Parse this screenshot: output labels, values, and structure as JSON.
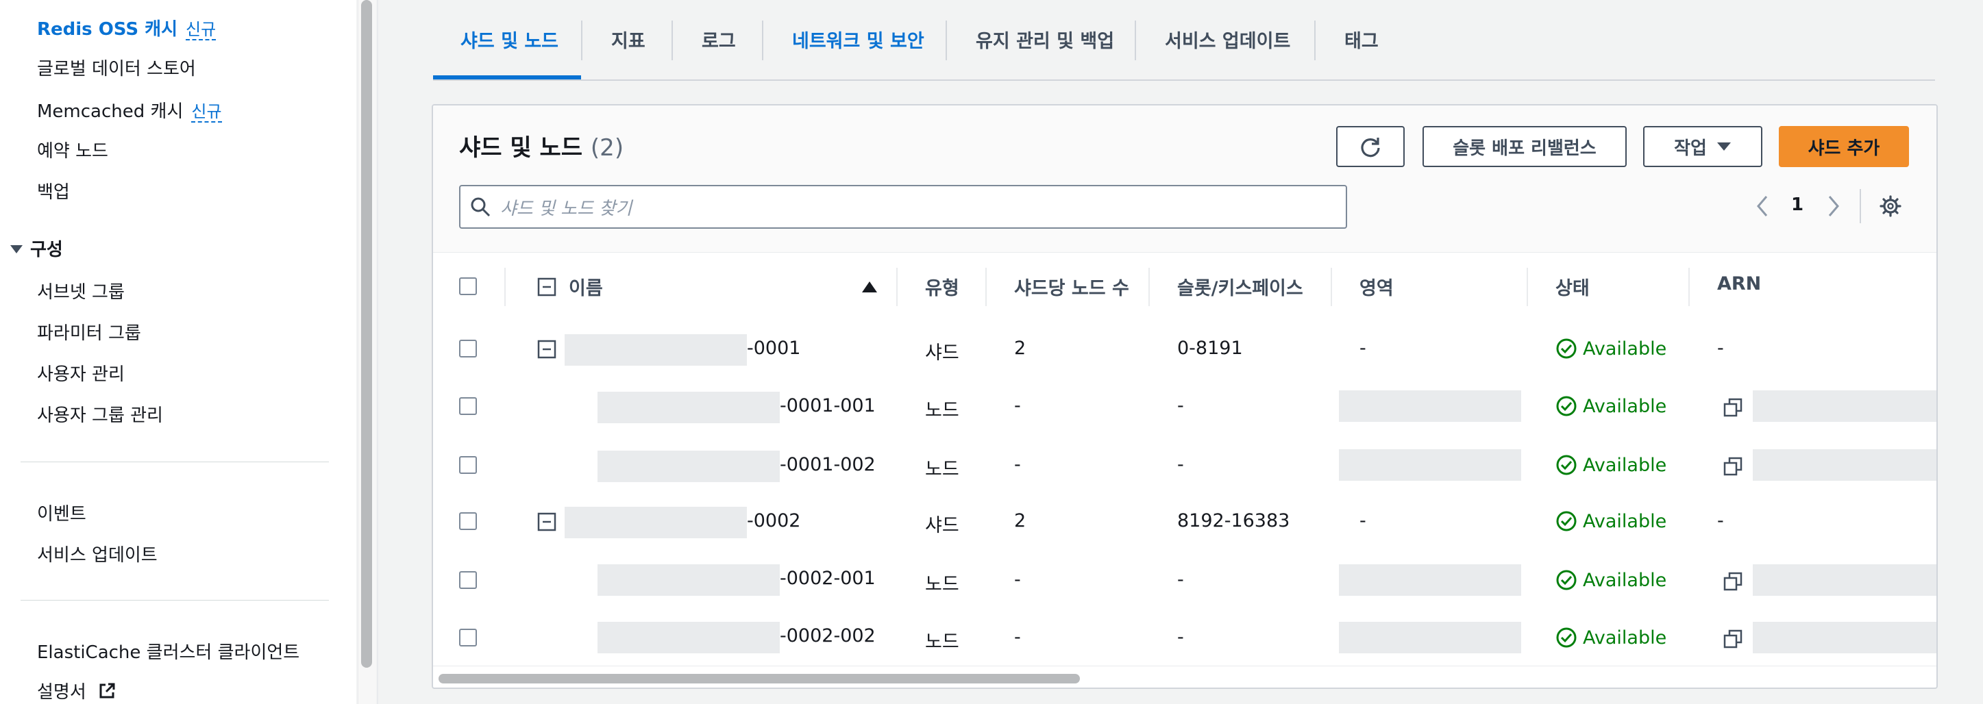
{
  "sidebar": {
    "items": [
      {
        "label": "Redis OSS 캐시",
        "badge": "신규"
      },
      {
        "label": "글로벌 데이터 스토어"
      },
      {
        "label": "Memcached 캐시",
        "badge": "신규"
      },
      {
        "label": "예약 노드"
      },
      {
        "label": "백업"
      }
    ],
    "section_label": "구성",
    "config_items": [
      "서브넷 그룹",
      "파라미터 그룹",
      "사용자 관리",
      "사용자 그룹 관리"
    ],
    "other_items": [
      "이벤트",
      "서비스 업데이트"
    ],
    "bottom_items": [
      "ElastiCache 클러스터 클라이언트",
      "설명서"
    ]
  },
  "tabs": [
    "샤드 및 노드",
    "지표",
    "로그",
    "네트워크 및 보안",
    "유지 관리 및 백업",
    "서비스 업데이트",
    "태그"
  ],
  "panel": {
    "title": "샤드 및 노드",
    "count": "(2)",
    "refresh_icon": "refresh-icon",
    "rebalance_label": "슬롯 배포 리밸런스",
    "actions_label": "작업",
    "add_shard_label": "샤드 추가",
    "search_placeholder": "샤드 및 노드 찾기",
    "page": "1"
  },
  "table": {
    "columns": [
      "이름",
      "유형",
      "샤드당 노드 수",
      "슬롯/키스페이스",
      "영역",
      "상태",
      "ARN"
    ],
    "rows": [
      {
        "name_suffix": "-0001",
        "type": "샤드",
        "nodes": "2",
        "slots": "0-8191",
        "zone": "-",
        "status": "Available",
        "arn": "-"
      },
      {
        "name_suffix": "-0001-001",
        "type": "노드",
        "nodes": "-",
        "slots": "-",
        "zone": "",
        "status": "Available",
        "arn": ""
      },
      {
        "name_suffix": "-0001-002",
        "type": "노드",
        "nodes": "-",
        "slots": "-",
        "zone": "",
        "status": "Available",
        "arn": ""
      },
      {
        "name_suffix": "-0002",
        "type": "샤드",
        "nodes": "2",
        "slots": "8192-16383",
        "zone": "-",
        "status": "Available",
        "arn": "-"
      },
      {
        "name_suffix": "-0002-001",
        "type": "노드",
        "nodes": "-",
        "slots": "-",
        "zone": "",
        "status": "Available",
        "arn": ""
      },
      {
        "name_suffix": "-0002-002",
        "type": "노드",
        "nodes": "-",
        "slots": "-",
        "zone": "",
        "status": "Available",
        "arn": ""
      }
    ]
  },
  "colors": {
    "accent": "#0972d3",
    "primary_button": "#f28e2b",
    "success": "#037f0c"
  }
}
